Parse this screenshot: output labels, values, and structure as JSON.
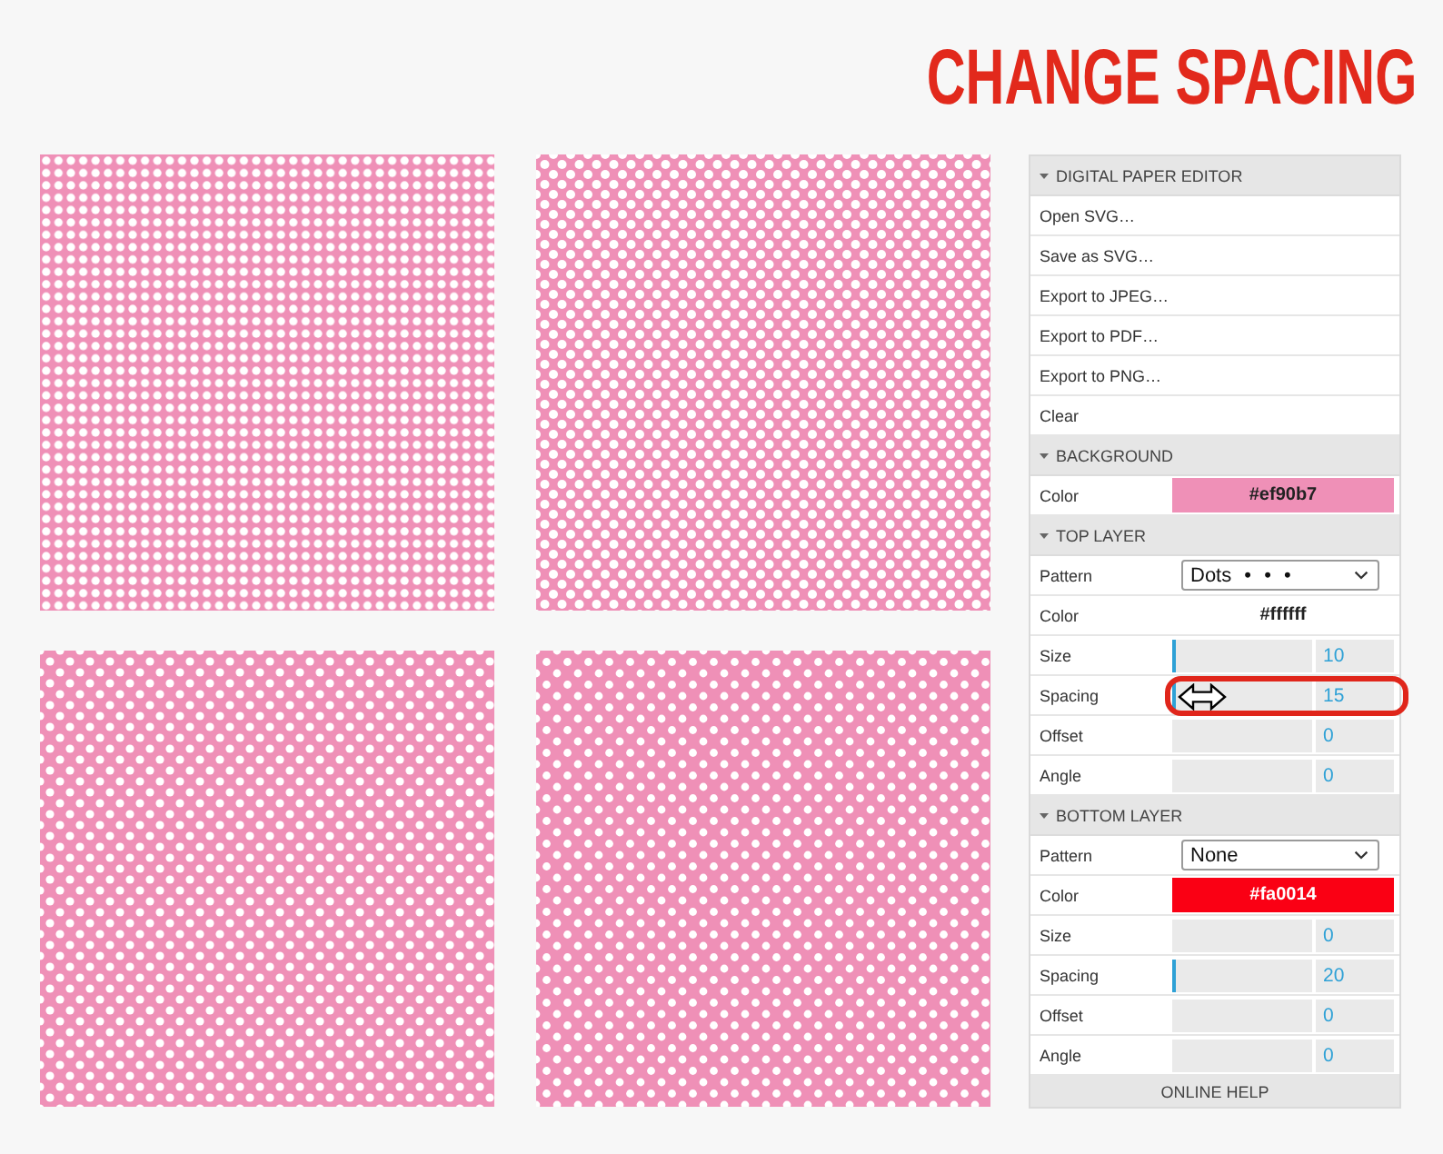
{
  "title": "CHANGE SPACING",
  "panel": {
    "sections": [
      {
        "title": "DIGITAL PAPER EDITOR",
        "expanded": true,
        "rows": [
          {
            "kind": "action",
            "label": "Open SVG…"
          },
          {
            "kind": "action",
            "label": "Save as SVG…"
          },
          {
            "kind": "action",
            "label": "Export to JPEG…"
          },
          {
            "kind": "action",
            "label": "Export to PDF…"
          },
          {
            "kind": "action",
            "label": "Export to PNG…"
          },
          {
            "kind": "action",
            "label": "Clear"
          }
        ]
      },
      {
        "title": "BACKGROUND",
        "expanded": true,
        "rows": [
          {
            "kind": "color",
            "label": "Color",
            "value": "#ef90b7",
            "color": "#ef90b7"
          }
        ]
      },
      {
        "title": "TOP LAYER",
        "expanded": true,
        "rows": [
          {
            "kind": "select",
            "label": "Pattern",
            "value": "Dots • • •"
          },
          {
            "kind": "color",
            "label": "Color",
            "value": "#ffffff",
            "color": "#ffffff"
          },
          {
            "kind": "slider",
            "label": "Size",
            "value": "10",
            "level": 0.03,
            "highlighted": false,
            "dragging": false
          },
          {
            "kind": "slider",
            "label": "Spacing",
            "value": "15",
            "level": 0.03,
            "highlighted": true,
            "dragging": true
          },
          {
            "kind": "slider",
            "label": "Offset",
            "value": "0",
            "highlighted": false,
            "dragging": false
          },
          {
            "kind": "slider",
            "label": "Angle",
            "value": "0",
            "highlighted": false,
            "dragging": false
          }
        ]
      },
      {
        "title": "BOTTOM LAYER",
        "expanded": true,
        "rows": [
          {
            "kind": "select",
            "label": "Pattern",
            "value": "None"
          },
          {
            "kind": "color",
            "label": "Color",
            "value": "#fa0014",
            "color": "#fa0014"
          },
          {
            "kind": "slider",
            "label": "Size",
            "value": "0",
            "highlighted": false,
            "dragging": false
          },
          {
            "kind": "slider",
            "label": "Spacing",
            "value": "20",
            "level": 0.03,
            "highlighted": false,
            "dragging": false
          },
          {
            "kind": "slider",
            "label": "Offset",
            "value": "0",
            "highlighted": false,
            "dragging": false
          },
          {
            "kind": "slider",
            "label": "Angle",
            "value": "0",
            "highlighted": false,
            "dragging": false
          }
        ]
      }
    ],
    "footer": "ONLINE HELP"
  }
}
